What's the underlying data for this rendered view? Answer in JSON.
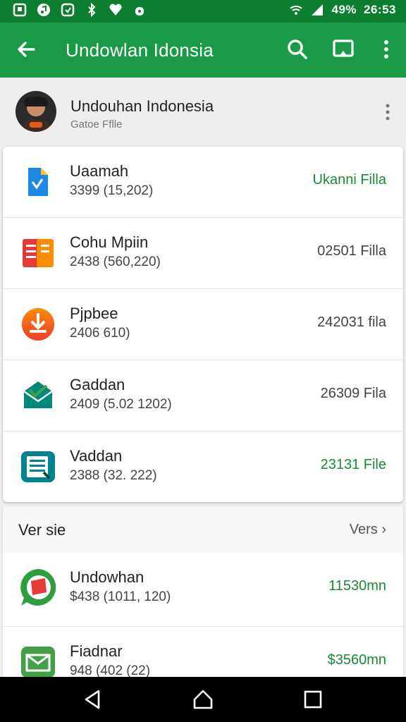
{
  "status_bar": {
    "battery_percent": "49%",
    "time": "26:53"
  },
  "app_bar": {
    "title": "Undowlan Idonsia"
  },
  "profile": {
    "name": "Undouhan Indonesia",
    "subtitle": "Gatoe Fflle"
  },
  "list_items": [
    {
      "title": "Uaamah",
      "subtitle": "3399 (15,202)",
      "right": "Ukanni Filla",
      "right_color": "#1b8a36",
      "icon": "file-icon"
    },
    {
      "title": "Cohu Mpiin",
      "subtitle": "2438 (560,220)",
      "right": "02501 Filla",
      "right_color": "#444444",
      "icon": "document-icon"
    },
    {
      "title": "Pjpbee",
      "subtitle": "2406 610)",
      "right": "242031 fila",
      "right_color": "#444444",
      "icon": "download-icon"
    },
    {
      "title": "Gaddan",
      "subtitle": "2409 (5.02 1202)",
      "right": "26309 Fila",
      "right_color": "#444444",
      "icon": "mail-icon"
    },
    {
      "title": "Vaddan",
      "subtitle": "2388 (32. 222)",
      "right": "23131 File",
      "right_color": "#1b8a36",
      "icon": "sheet-icon"
    }
  ],
  "section": {
    "label": "Ver sie",
    "more": "Vers"
  },
  "section_items": [
    {
      "title": "Undowhan",
      "subtitle": "$438 (1011, 120)",
      "right": "11530mn",
      "right_color": "#1b8a36",
      "icon": "chat-icon"
    },
    {
      "title": "Fiadnar",
      "subtitle": "948 (402 (22)",
      "right": "$3560mn",
      "right_color": "#1b8a36",
      "icon": "mail-green-icon"
    }
  ],
  "colors": {
    "status_bar": "#0d7e2e",
    "app_bar": "#1a9a44",
    "accent_green": "#1b8a36"
  }
}
